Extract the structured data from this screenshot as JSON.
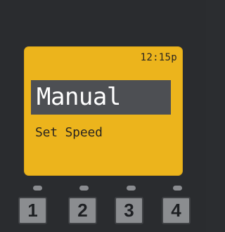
{
  "display": {
    "time": "12:15p",
    "mode": "Manual",
    "subtitle": "Set Speed"
  },
  "keypad": {
    "buttons": [
      "1",
      "2",
      "3",
      "4"
    ]
  },
  "colors": {
    "screen_background": "#ecb41c",
    "mode_highlight": "#4d4f53",
    "device_body": "#2a2c2f",
    "key_face": "#8b8d90",
    "indicator_led": "#8a8c90"
  }
}
